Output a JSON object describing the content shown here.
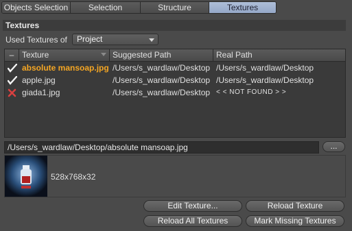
{
  "tabs": [
    "Objects Selection",
    "Selection",
    "Structure",
    "Textures"
  ],
  "section_title": "Textures",
  "used_textures": {
    "label": "Used Textures of",
    "value": "Project"
  },
  "table": {
    "headers": [
      "–",
      "Texture",
      "Suggested Path",
      "Real Path"
    ],
    "rows": [
      {
        "status": "ok",
        "texture": "absolute mansoap.jpg",
        "suggested": "/Users/s_wardlaw/Desktop",
        "real": "/Users/s_wardlaw/Desktop"
      },
      {
        "status": "ok",
        "texture": "apple.jpg",
        "suggested": "/Users/s_wardlaw/Desktop",
        "real": "/Users/s_wardlaw/Desktop"
      },
      {
        "status": "missing",
        "texture": "giada1.jpg",
        "suggested": "/Users/s_wardlaw/Desktop",
        "real": "< < NOT FOUND > >"
      }
    ]
  },
  "path_field": {
    "value": "/Users/s_wardlaw/Desktop/absolute mansoap.jpg"
  },
  "browse_label": "...",
  "preview": {
    "dimensions": "528x768x32"
  },
  "buttons": {
    "edit": "Edit Texture...",
    "reload": "Reload Texture",
    "reload_all": "Reload All Textures",
    "mark_missing": "Mark Missing Textures"
  },
  "colors": {
    "accent_selected": "#f5a623",
    "tab_active": "#a3b4d2",
    "missing": "#d94040"
  }
}
